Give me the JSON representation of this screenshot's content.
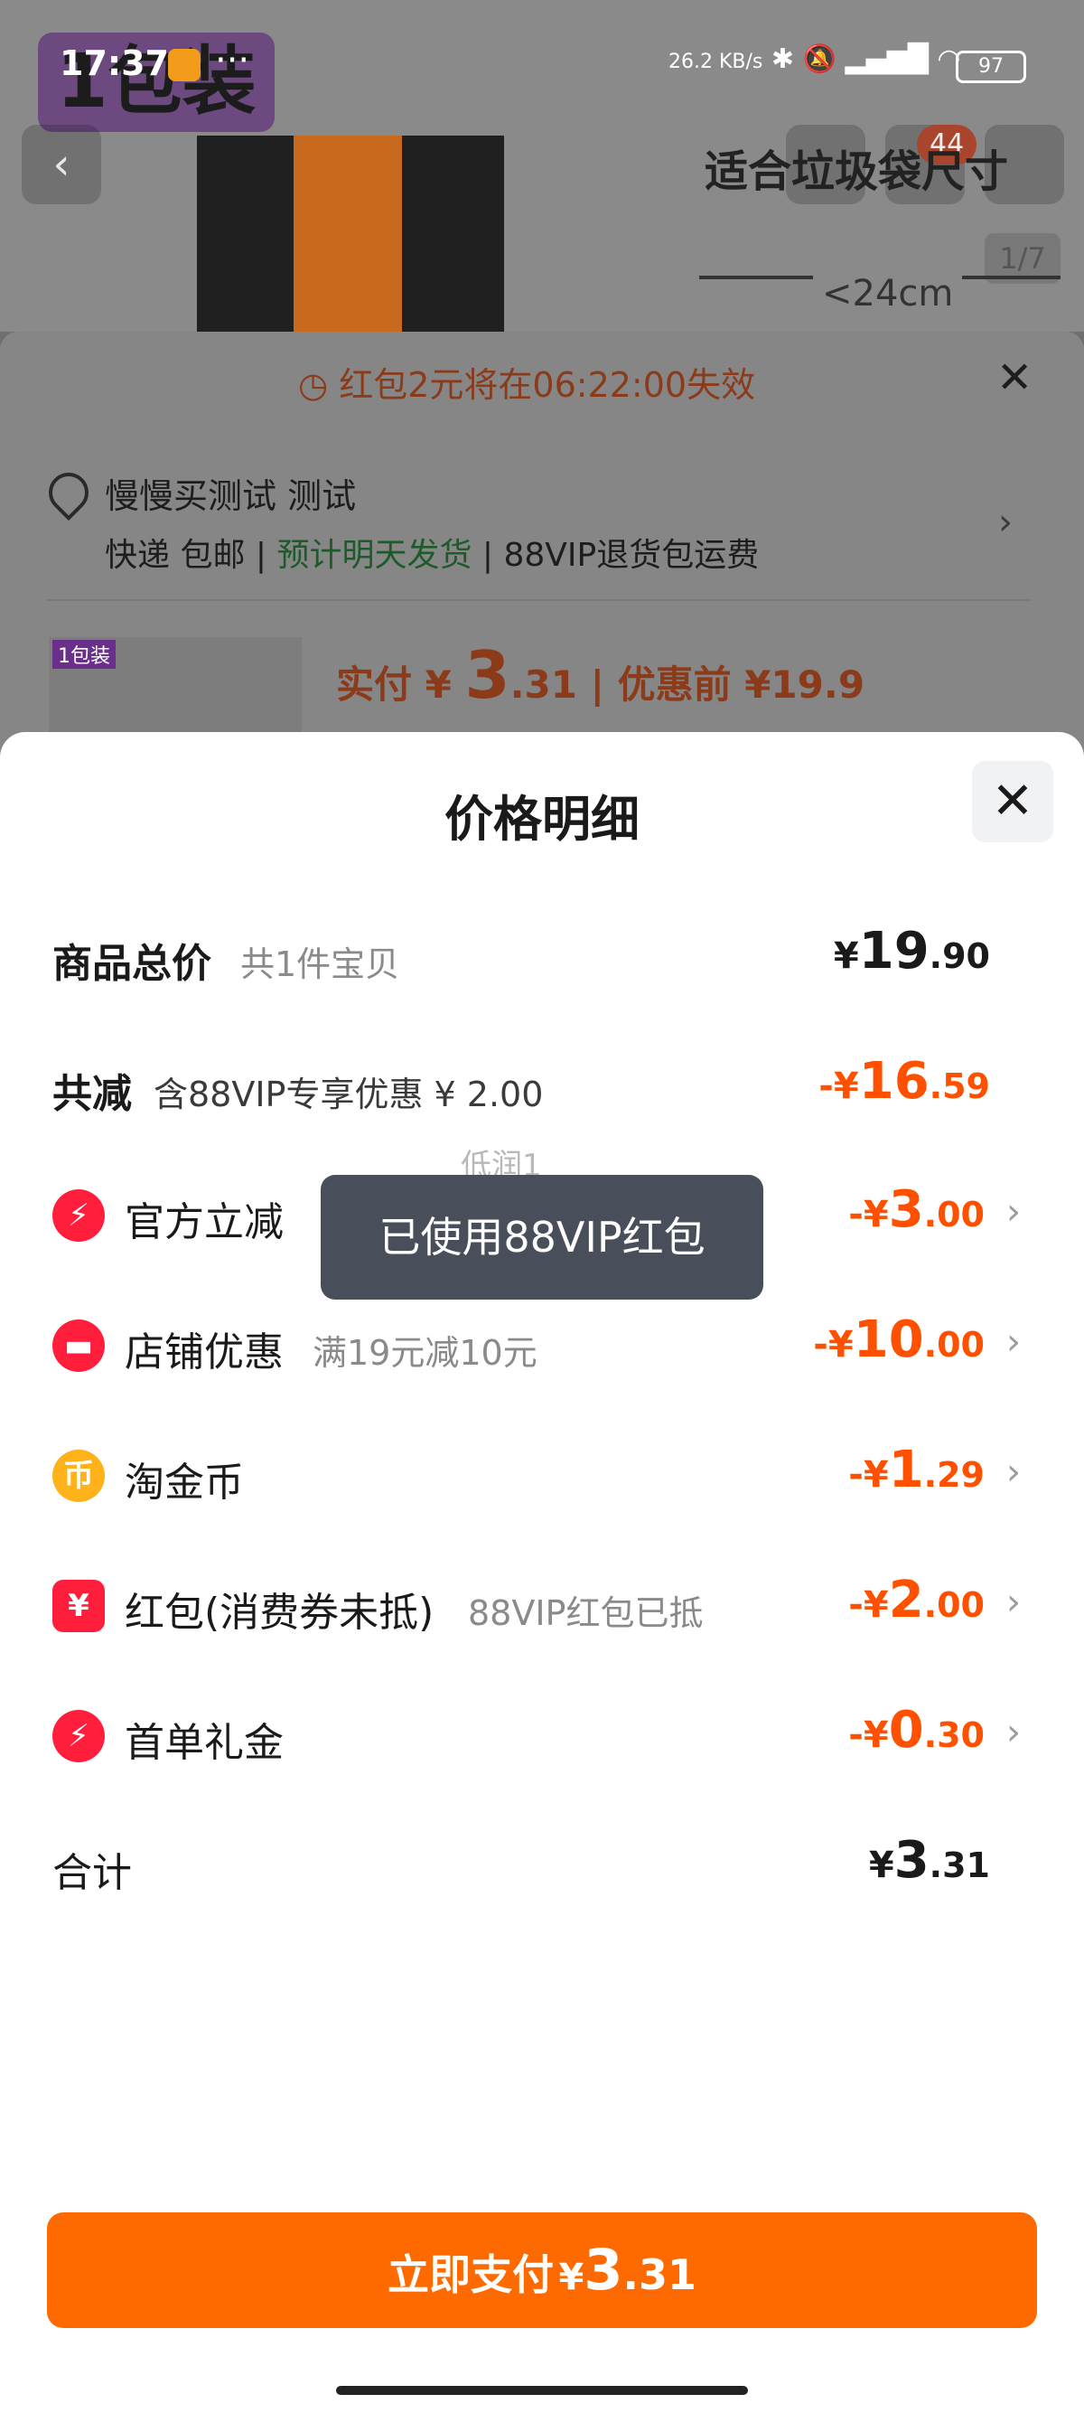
{
  "status_bar": {
    "time": "17:37",
    "net_speed": "26.2 KB/s",
    "battery": "97"
  },
  "background": {
    "logo_text": "1包装",
    "size_title": "适合垃圾袋尺寸",
    "image_counter": "1/7",
    "measure_label": "<24cm",
    "badge_count": "44",
    "timer_text": "红包2元将在06:22:00失效",
    "address": "慢慢买测试 测试",
    "ship_express": "快递 包邮",
    "ship_eta": "预计明天发货",
    "ship_return": "88VIP退货包运费",
    "thumb_tag": "1包装",
    "paid_prefix": "实付 ¥ ",
    "paid_int": "3",
    "paid_dec": ".31",
    "paid_before": "优惠前 ¥19.9"
  },
  "sheet": {
    "title": "价格明细",
    "rows": [
      {
        "label": "商品总价",
        "sub": "共1件宝贝",
        "cur": "¥",
        "int": "19",
        "dec": ".90"
      },
      {
        "label": "共减",
        "sub": "含88VIP专享优惠 ¥ 2.00",
        "cur": "-¥",
        "int": "16",
        "dec": ".59"
      },
      {
        "label": "官方立减",
        "sub": "",
        "cur": "-¥",
        "int": "3",
        "dec": ".00"
      },
      {
        "label": "店铺优惠",
        "sub": "满19元减10元",
        "cur": "-¥",
        "int": "10",
        "dec": ".00"
      },
      {
        "label": "淘金币",
        "sub": "",
        "cur": "-¥",
        "int": "1",
        "dec": ".29"
      },
      {
        "label": "红包(消费券未抵)",
        "sub": "88VIP红包已抵",
        "cur": "-¥",
        "int": "2",
        "dec": ".00"
      },
      {
        "label": "首单礼金",
        "sub": "",
        "cur": "-¥",
        "int": "0",
        "dec": ".30"
      },
      {
        "label": "合计",
        "sub": "",
        "cur": "¥",
        "int": "3",
        "dec": ".31"
      }
    ],
    "toast": "已使用88VIP红包",
    "toast_ghost": "低润1"
  },
  "pay_button": {
    "label": "立即支付",
    "cur": "¥",
    "int": "3",
    "dec": ".31"
  },
  "colors": {
    "accent": "#ff6a00",
    "discount": "#ff5000",
    "icon_red": "#ff1f3d",
    "icon_gold": "#ffb21a"
  }
}
